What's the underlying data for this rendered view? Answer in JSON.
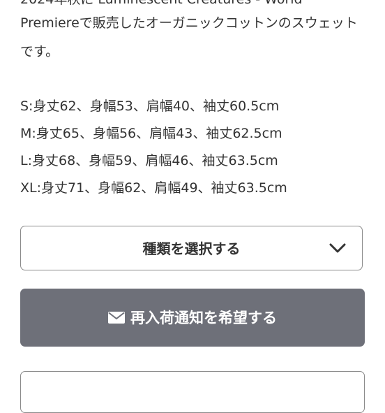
{
  "description": {
    "lines": [
      "2024年秋に Luminescent Creatures - World",
      "Premiereで販売したオーガニックコットンのスウェット",
      "です。"
    ]
  },
  "sizes": [
    "S:身丈62、身幅53、肩幅40、袖丈60.5cm",
    "M:身丈65、身幅56、肩幅43、袖丈62.5cm",
    "L:身丈68、身幅59、肩幅46、袖丈63.5cm",
    "XL:身丈71、身幅62、肩幅49、袖丈63.5cm"
  ],
  "variant_select": {
    "label": "種類を選択する",
    "icon": "chevron-down-icon"
  },
  "restock_button": {
    "label": "再入荷通知を希望する",
    "icon": "mail-icon",
    "background": "#6e7079",
    "text_color": "#ffffff"
  },
  "colors": {
    "text": "#333333",
    "border": "#8a8a8a",
    "background": "#ffffff"
  }
}
